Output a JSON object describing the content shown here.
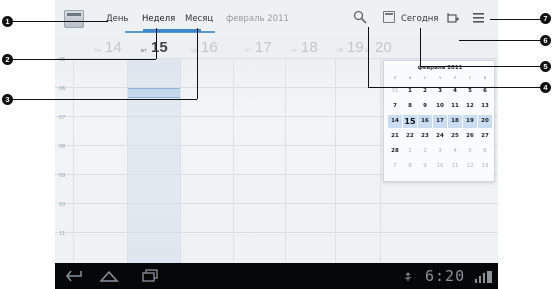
{
  "actionbar": {
    "tabs": [
      "День",
      "Неделя",
      "Месяц"
    ],
    "month_label": "февраль 2011",
    "today_label": "Сегодня",
    "icons": {
      "app": "calendar-app-icon",
      "search": "search-icon",
      "today": "calendar-today-icon",
      "new_event": "new-event-icon",
      "menu": "menu-icon"
    }
  },
  "week_days": [
    {
      "name": "пн",
      "date": "14"
    },
    {
      "name": "вт",
      "date": "15"
    },
    {
      "name": "ср",
      "date": "16"
    },
    {
      "name": "чт",
      "date": "17"
    },
    {
      "name": "пт",
      "date": "18"
    },
    {
      "name": "сб",
      "date": "19"
    },
    {
      "name": "вс",
      "date": "20"
    }
  ],
  "hours": [
    "05",
    "06",
    "07",
    "08",
    "09",
    "10",
    "11"
  ],
  "mini_month": {
    "title": "февраль 2011",
    "dow": [
      "п",
      "в",
      "с",
      "ч",
      "п",
      "с",
      "в"
    ],
    "weeks": [
      [
        "31",
        "1",
        "2",
        "3",
        "4",
        "5",
        "6"
      ],
      [
        "7",
        "8",
        "9",
        "10",
        "11",
        "12",
        "13"
      ],
      [
        "14",
        "15",
        "16",
        "17",
        "18",
        "19",
        "20"
      ],
      [
        "21",
        "22",
        "23",
        "24",
        "25",
        "26",
        "27"
      ],
      [
        "28",
        "1",
        "2",
        "3",
        "4",
        "5",
        "6"
      ],
      [
        "7",
        "8",
        "9",
        "10",
        "11",
        "12",
        "13"
      ]
    ]
  },
  "navbar": {
    "clock": "6:20",
    "icons": [
      "back-icon",
      "home-icon",
      "recent-apps-icon"
    ]
  },
  "callouts": [
    "1",
    "2",
    "3",
    "4",
    "5",
    "6",
    "7"
  ],
  "colors": {
    "accent": "#3b88cc",
    "navbar": "#050708"
  }
}
